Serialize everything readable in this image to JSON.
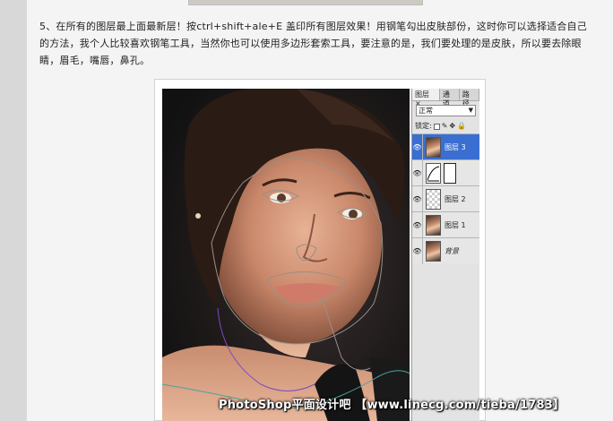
{
  "article": {
    "paragraph": "5、在所有的图层最上面最新层！按ctrl+shift+ale+E 盖印所有图层效果！用钢笔勾出皮肤部份，这时你可以选择适合自己的方法，我个人比较喜欢钢笔工具，当然你也可以使用多边形套索工具，要注意的是，我们要处理的是皮肤，所以要去除眼睛，眉毛，嘴唇，鼻孔。"
  },
  "layers_panel": {
    "tabs": [
      "图层 ×",
      "通道",
      "路径"
    ],
    "blend_mode": "正常",
    "lock_label": "锁定:",
    "layers": [
      {
        "name": "图层 3",
        "thumb": "portrait",
        "selected": true
      },
      {
        "name": "",
        "thumb": "curves",
        "selected": false,
        "has_mask": true
      },
      {
        "name": "图层 2",
        "thumb": "checker",
        "selected": false
      },
      {
        "name": "图层 1",
        "thumb": "portrait",
        "selected": false
      },
      {
        "name": "背景",
        "thumb": "portrait",
        "selected": false,
        "italic": true
      }
    ]
  },
  "watermark": "PhotoShop平面设计吧 【www.linecg.com/tieba/1783】",
  "colors": {
    "selection_blue": "#3a6fd1",
    "path_outline": "#9a8f86",
    "path_purple": "#7a4bbd",
    "path_teal": "#4aa39a"
  }
}
